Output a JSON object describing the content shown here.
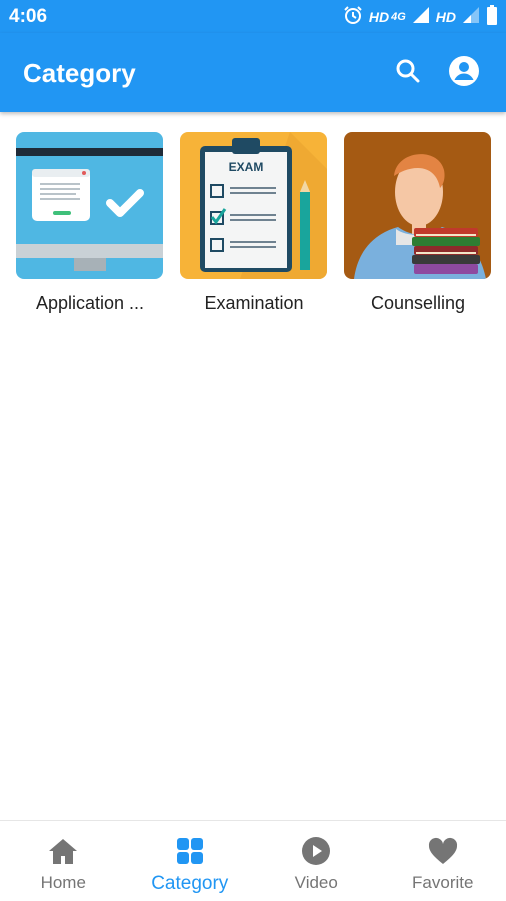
{
  "status_bar": {
    "time": "4:06",
    "hd1": "HD",
    "network": "4G",
    "hd2": "HD",
    "icons": [
      "alarm-icon",
      "signal-icon",
      "battery-icon"
    ]
  },
  "app_bar": {
    "title": "Category",
    "actions": [
      "search-icon",
      "account-icon"
    ],
    "color": "#2196f3"
  },
  "categories": [
    {
      "label": "Application ...",
      "image": "monitor-checkmark-illustration"
    },
    {
      "label": "Examination",
      "image": "exam-clipboard-illustration"
    },
    {
      "label": "Counselling",
      "image": "person-with-books-illustration"
    }
  ],
  "bottom_nav": {
    "active_color": "#2196f3",
    "inactive_color": "#757575",
    "items": [
      {
        "label": "Home",
        "icon": "home-icon",
        "active": false
      },
      {
        "label": "Category",
        "icon": "grid-icon",
        "active": true
      },
      {
        "label": "Video",
        "icon": "play-circle-icon",
        "active": false
      },
      {
        "label": "Favorite",
        "icon": "heart-icon",
        "active": false
      }
    ]
  }
}
